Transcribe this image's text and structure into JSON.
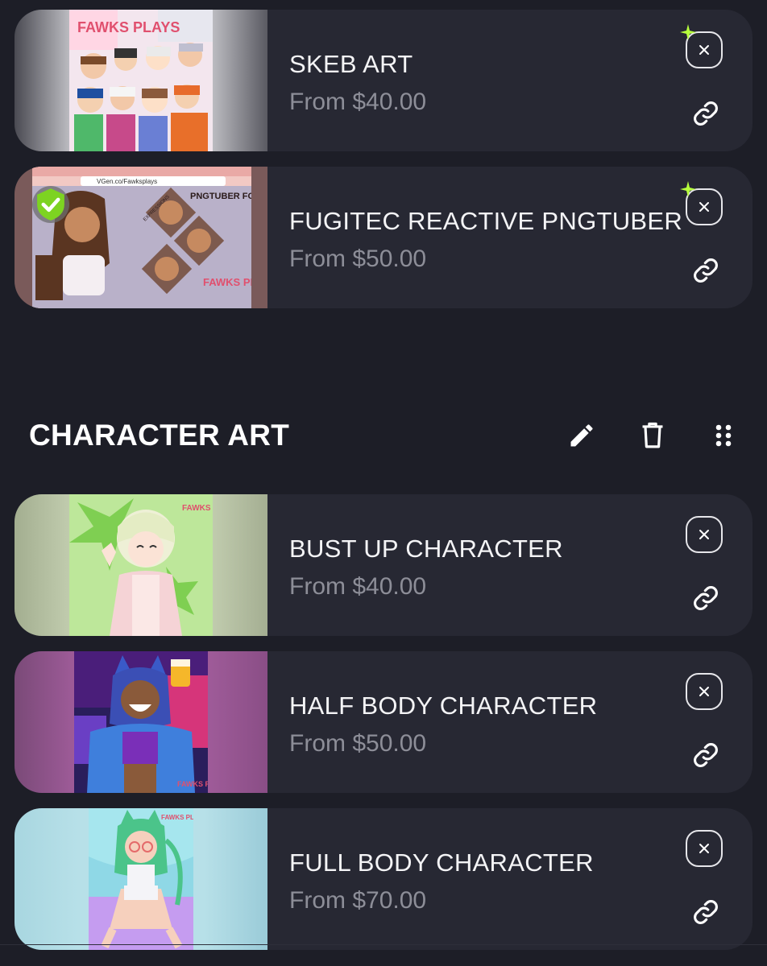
{
  "group_top": {
    "items": [
      {
        "title": "SKEB ART",
        "price": "From $40.00",
        "has_sparkle": true,
        "checked": false,
        "thumb_icon": "fawks-plays-group-art-image"
      },
      {
        "title": "FUGITEC REACTIVE PNGTUBER",
        "price": "From $50.00",
        "has_sparkle": true,
        "checked": true,
        "thumb_icon": "pngtuber-preview-image"
      }
    ]
  },
  "character_section": {
    "title": "CHARACTER ART",
    "icons": [
      "pencil-icon",
      "trash-icon",
      "drag-handle-icon"
    ],
    "items": [
      {
        "title": "BUST UP CHARACTER",
        "price": "From $40.00",
        "has_sparkle": false,
        "thumb_icon": "bust-up-art-image"
      },
      {
        "title": "HALF BODY CHARACTER",
        "price": "From $50.00",
        "has_sparkle": false,
        "thumb_icon": "half-body-art-image"
      },
      {
        "title": "FULL BODY CHARACTER",
        "price": "From $70.00",
        "has_sparkle": false,
        "thumb_icon": "full-body-art-image"
      }
    ]
  },
  "thumb_texts": {
    "url": "VGen.co/Fawksplays",
    "pngtuber_caption": "PNGTUBER FOR EPPERVT",
    "expressions": "EXPRESSIONS",
    "brand": "FAWKS PLAYS"
  },
  "colors": {
    "background": "#1d1e27",
    "card": "#272833",
    "price_text": "#8d8e98",
    "sparkle": "#b7ff3c",
    "check_badge": "#7dd321"
  }
}
